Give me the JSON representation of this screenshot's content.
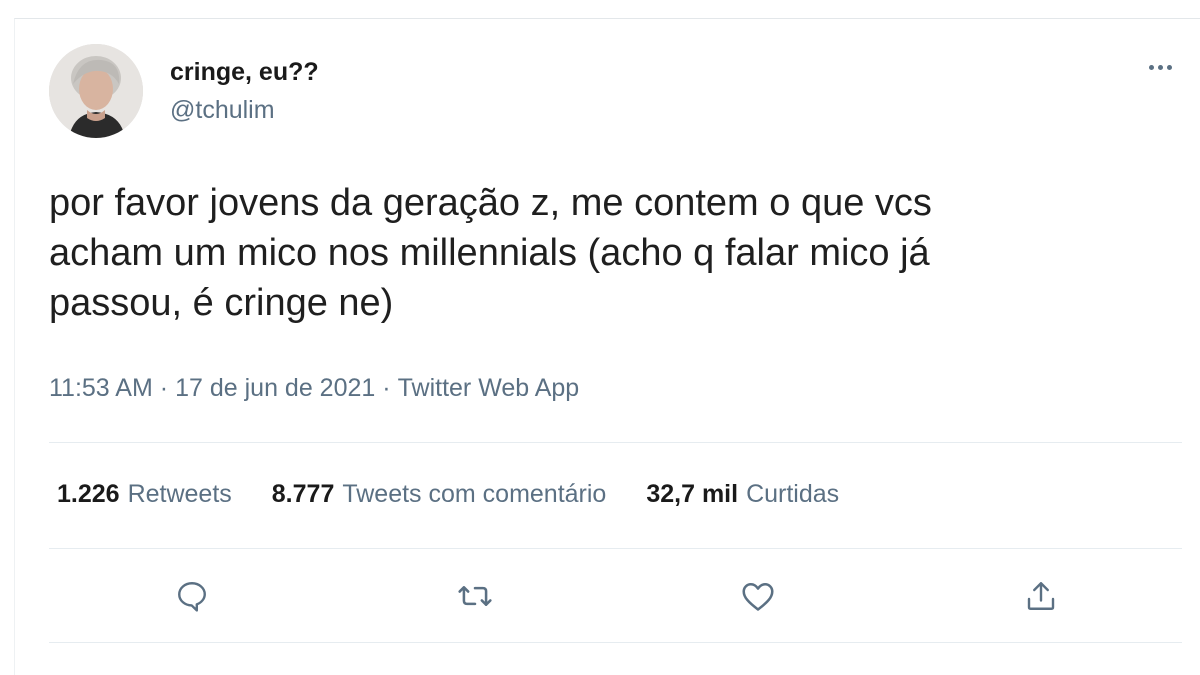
{
  "tweet": {
    "author_name": "cringe, eu??",
    "author_handle": "@tchulim",
    "text": "por favor jovens da geração z, me contem o que vcs\nacham um mico nos millennials (acho q falar mico já\npassou, é cringe ne)",
    "time": "11:53 AM",
    "separator": "·",
    "date": "17 de jun de 2021",
    "source": "Twitter Web App"
  },
  "stats": {
    "retweets_count": "1.226",
    "retweets_label": "Retweets",
    "quotes_count": "8.777",
    "quotes_label": "Tweets com comentário",
    "likes_count": "32,7 mil",
    "likes_label": "Curtidas"
  },
  "icons": {
    "more": "more-horizontal-icon",
    "reply": "reply-icon",
    "retweet": "retweet-icon",
    "like": "heart-icon",
    "share": "share-icon"
  },
  "colors": {
    "text": "#1f1f1f",
    "secondary": "#5b7083",
    "divider": "#e6ecf0"
  }
}
